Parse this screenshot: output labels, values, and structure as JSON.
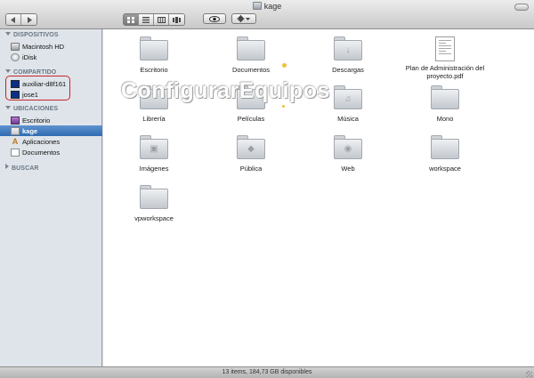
{
  "window": {
    "title": "kage"
  },
  "toolbar": {
    "nav": [
      "back-icon",
      "forward-icon"
    ],
    "views": [
      "icon-view-icon",
      "list-view-icon",
      "column-view-icon",
      "coverflow-view-icon"
    ],
    "quicklook": "eye-icon",
    "action": "gear-icon"
  },
  "sidebar": {
    "devices": {
      "title": "DISPOSITIVOS",
      "items": [
        {
          "label": "Macintosh HD",
          "icon": "hard-disk-icon"
        },
        {
          "label": "iDisk",
          "icon": "idisk-icon"
        }
      ]
    },
    "shared": {
      "title": "COMPARTIDO",
      "items": [
        {
          "label": "auxiliar-d8f161",
          "icon": "monitor-icon"
        },
        {
          "label": "jose1",
          "icon": "monitor-icon"
        }
      ]
    },
    "places": {
      "title": "UBICACIONES",
      "items": [
        {
          "label": "Escritorio",
          "icon": "desktop-icon"
        },
        {
          "label": "kage",
          "icon": "home-icon",
          "selected": true
        },
        {
          "label": "Aplicaciones",
          "icon": "applications-icon"
        },
        {
          "label": "Documentos",
          "icon": "documents-icon"
        }
      ]
    },
    "search": {
      "title": "BUSCAR"
    }
  },
  "files": [
    {
      "label": "Escritorio",
      "icon": "folder-icon"
    },
    {
      "label": "Documentos",
      "icon": "folder-icon"
    },
    {
      "label": "Descargas",
      "icon": "folder-icon"
    },
    {
      "label": "Plan de Administración del proyecto.pdf",
      "icon": "pdf-document-icon"
    },
    {
      "label": "Librería",
      "icon": "folder-icon"
    },
    {
      "label": "Películas",
      "icon": "folder-icon"
    },
    {
      "label": "Música",
      "icon": "folder-icon"
    },
    {
      "label": "Mono",
      "icon": "folder-icon"
    },
    {
      "label": "Imágenes",
      "icon": "folder-icon"
    },
    {
      "label": "Pública",
      "icon": "folder-icon"
    },
    {
      "label": "Web",
      "icon": "folder-icon"
    },
    {
      "label": "workspace",
      "icon": "folder-icon"
    },
    {
      "label": "vpworkspace",
      "icon": "folder-icon"
    }
  ],
  "watermark": {
    "text": "ConfigurarEquipos"
  },
  "status": {
    "text": "13 items, 184,73 GB disponibles"
  },
  "colors": {
    "selection": "#3f7ec3",
    "highlight_border": "#c7242b",
    "sidebar_bg": "#dee4ea"
  }
}
